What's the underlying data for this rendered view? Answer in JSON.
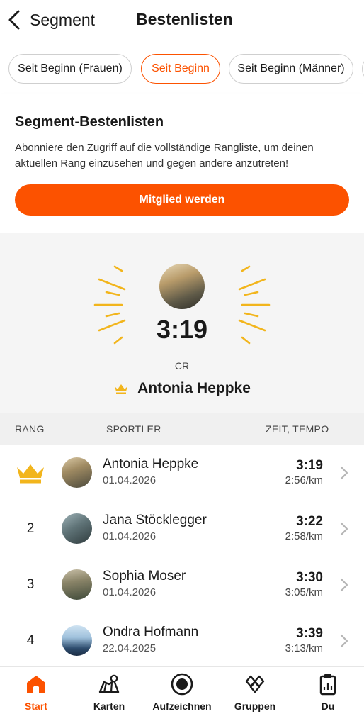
{
  "header": {
    "back_label": "Segment",
    "title": "Bestenlisten"
  },
  "filters": [
    {
      "label": "Seit Beginn (Frauen)",
      "active": false
    },
    {
      "label": "Seit Beginn",
      "active": true
    },
    {
      "label": "Seit Beginn (Männer)",
      "active": false
    }
  ],
  "promo": {
    "title": "Segment-Bestenlisten",
    "text": "Abonniere den Zugriff auf die vollständige Rangliste, um deinen aktuellen Rang einzusehen und gegen andere anzutreten!",
    "button_label": "Mitglied werden"
  },
  "champion": {
    "time": "3:19",
    "label": "CR",
    "name": "Antonia Heppke",
    "icon": "crown-icon"
  },
  "table": {
    "headers": {
      "rank": "RANG",
      "athlete": "SPORTLER",
      "time": "ZEIT, TEMPO"
    },
    "rows": [
      {
        "rank": "1",
        "crown": true,
        "name": "Antonia Heppke",
        "date": "01.04.2026",
        "time": "3:19",
        "pace": "2:56/km"
      },
      {
        "rank": "2",
        "crown": false,
        "name": "Jana Stöcklegger",
        "date": "01.04.2026",
        "time": "3:22",
        "pace": "2:58/km"
      },
      {
        "rank": "3",
        "crown": false,
        "name": "Sophia Moser",
        "date": "01.04.2026",
        "time": "3:30",
        "pace": "3:05/km"
      },
      {
        "rank": "4",
        "crown": false,
        "name": "Ondra Hofmann",
        "date": "22.04.2025",
        "time": "3:39",
        "pace": "3:13/km"
      }
    ]
  },
  "nav": [
    {
      "label": "Start",
      "icon": "home-icon",
      "active": true
    },
    {
      "label": "Karten",
      "icon": "map-icon",
      "active": false
    },
    {
      "label": "Aufzeichnen",
      "icon": "record-icon",
      "active": false
    },
    {
      "label": "Gruppen",
      "icon": "groups-icon",
      "active": false
    },
    {
      "label": "Du",
      "icon": "clipboard-icon",
      "active": false
    }
  ],
  "colors": {
    "accent": "#fc5200",
    "gold": "#f2b51c"
  }
}
